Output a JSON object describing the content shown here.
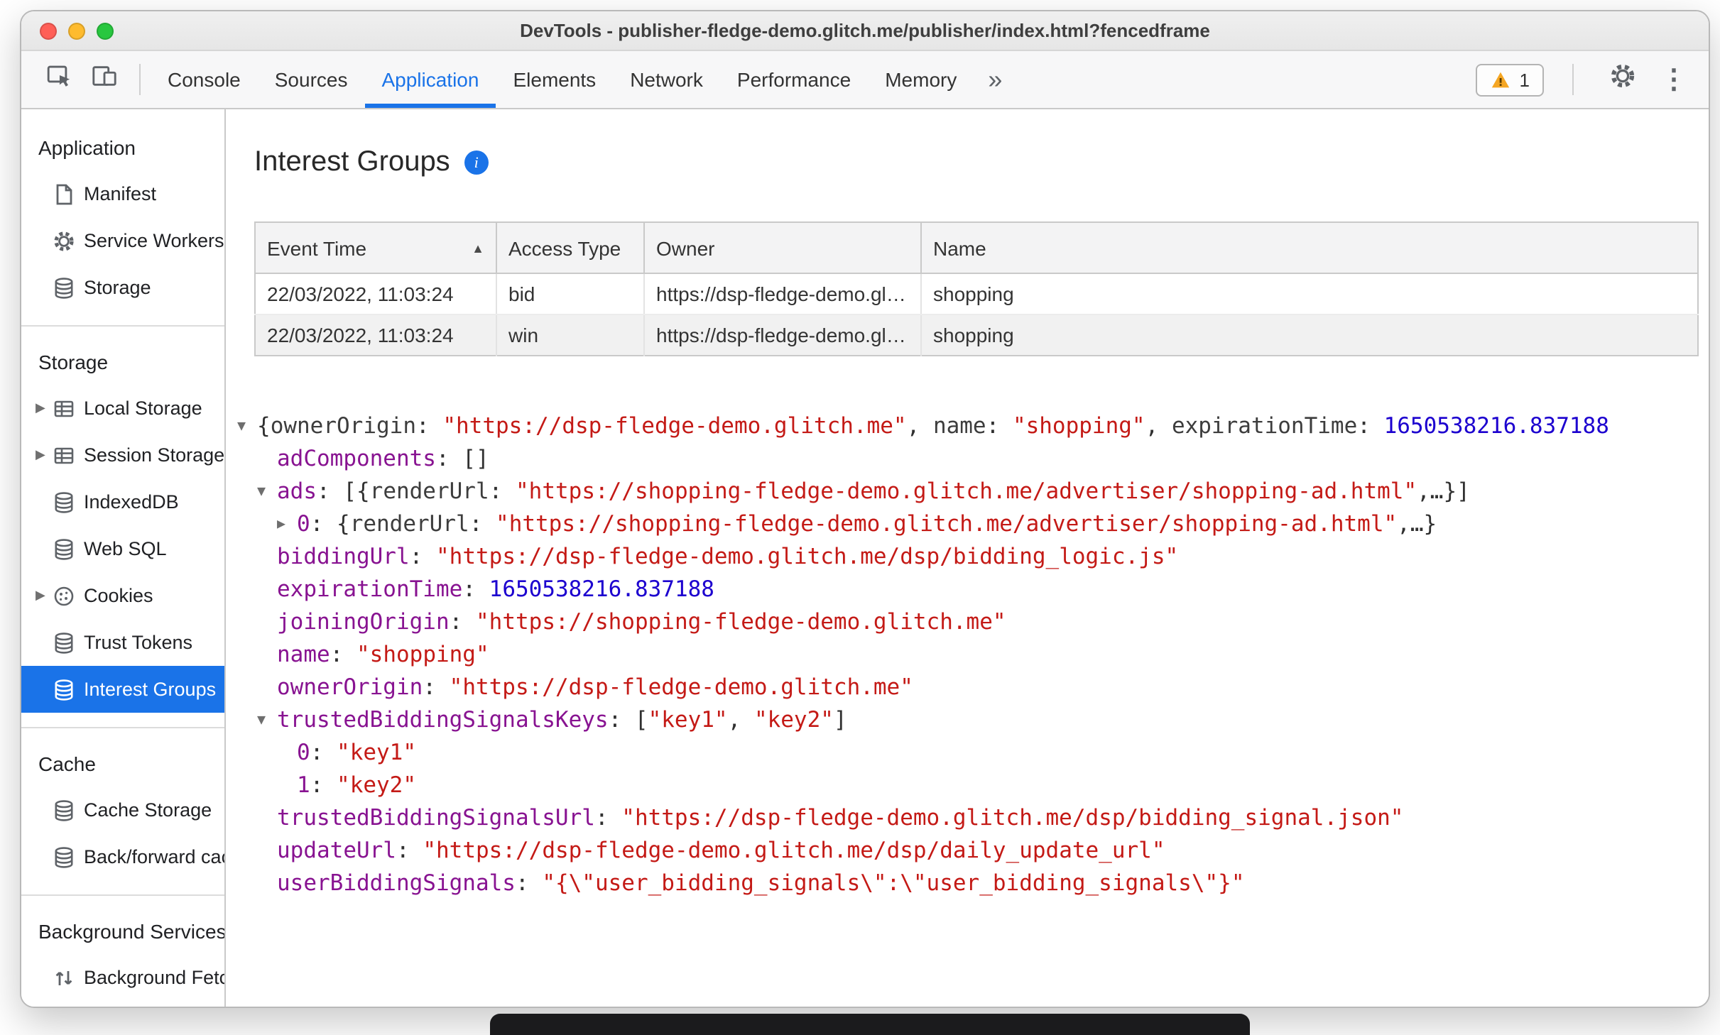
{
  "window_title": "DevTools - publisher-fledge-demo.glitch.me/publisher/index.html?fencedframe",
  "colors": {
    "accent": "#1a73e8",
    "selected_item_bg": "#1a73e8",
    "tree_key": "#881391",
    "tree_string": "#c41a16",
    "tree_number": "#1c00cf",
    "warning": "#f5a623"
  },
  "toolbar": {
    "tabs": [
      {
        "label": "Console"
      },
      {
        "label": "Sources"
      },
      {
        "label": "Application",
        "active": true
      },
      {
        "label": "Elements"
      },
      {
        "label": "Network"
      },
      {
        "label": "Performance"
      },
      {
        "label": "Memory"
      }
    ],
    "more_tabs_label": "»",
    "issues_count": "1"
  },
  "sidebar": {
    "sections": [
      {
        "title": "Application",
        "items": [
          {
            "label": "Manifest",
            "icon": "manifest"
          },
          {
            "label": "Service Workers",
            "icon": "gear"
          },
          {
            "label": "Storage",
            "icon": "database"
          }
        ]
      },
      {
        "title": "Storage",
        "items": [
          {
            "label": "Local Storage",
            "icon": "grid",
            "expandable": true
          },
          {
            "label": "Session Storage",
            "icon": "grid",
            "expandable": true
          },
          {
            "label": "IndexedDB",
            "icon": "database"
          },
          {
            "label": "Web SQL",
            "icon": "database"
          },
          {
            "label": "Cookies",
            "icon": "cookie",
            "expandable": true
          },
          {
            "label": "Trust Tokens",
            "icon": "database"
          },
          {
            "label": "Interest Groups",
            "icon": "database",
            "selected": true
          }
        ]
      },
      {
        "title": "Cache",
        "items": [
          {
            "label": "Cache Storage",
            "icon": "database"
          },
          {
            "label": "Back/forward cache",
            "icon": "database"
          }
        ]
      },
      {
        "title": "Background Services",
        "items": [
          {
            "label": "Background Fetch",
            "icon": "updown"
          }
        ]
      }
    ]
  },
  "main": {
    "heading": "Interest Groups",
    "table": {
      "columns": [
        {
          "label": "Event Time",
          "sort": "asc"
        },
        {
          "label": "Access Type"
        },
        {
          "label": "Owner"
        },
        {
          "label": "Name"
        }
      ],
      "rows": [
        [
          "22/03/2022, 11:03:24",
          "bid",
          "https://dsp-fledge-demo.glitch.me",
          "shopping"
        ],
        [
          "22/03/2022, 11:03:24",
          "win",
          "https://dsp-fledge-demo.glitch.me",
          "shopping"
        ]
      ]
    },
    "tree": {
      "lines": [
        {
          "indent": 0,
          "arrow": "expanded",
          "segments": [
            [
              "p",
              "{"
            ],
            [
              "pk",
              "ownerOrigin"
            ],
            [
              "p",
              ": "
            ],
            [
              "s",
              "\"https://dsp-fledge-demo.glitch.me\""
            ],
            [
              "p",
              ", "
            ],
            [
              "pk",
              "name"
            ],
            [
              "p",
              ": "
            ],
            [
              "s",
              "\"shopping\""
            ],
            [
              "p",
              ", "
            ],
            [
              "pk",
              "expirationTime"
            ],
            [
              "p",
              ": "
            ],
            [
              "n",
              "1650538216.837188"
            ]
          ]
        },
        {
          "indent": 1,
          "arrow": null,
          "segments": [
            [
              "k",
              "adComponents"
            ],
            [
              "p",
              ": []"
            ]
          ]
        },
        {
          "indent": 1,
          "arrow": "expanded",
          "segments": [
            [
              "k",
              "ads"
            ],
            [
              "p",
              ": [{"
            ],
            [
              "pk",
              "renderUrl"
            ],
            [
              "p",
              ": "
            ],
            [
              "s",
              "\"https://shopping-fledge-demo.glitch.me/advertiser/shopping-ad.html\""
            ],
            [
              "p",
              ",…}]"
            ]
          ]
        },
        {
          "indent": 2,
          "arrow": "collapsed",
          "segments": [
            [
              "k",
              "0"
            ],
            [
              "p",
              ": {"
            ],
            [
              "pk",
              "renderUrl"
            ],
            [
              "p",
              ": "
            ],
            [
              "s",
              "\"https://shopping-fledge-demo.glitch.me/advertiser/shopping-ad.html\""
            ],
            [
              "p",
              ",…}"
            ]
          ]
        },
        {
          "indent": 1,
          "arrow": null,
          "segments": [
            [
              "k",
              "biddingUrl"
            ],
            [
              "p",
              ": "
            ],
            [
              "s",
              "\"https://dsp-fledge-demo.glitch.me/dsp/bidding_logic.js\""
            ]
          ]
        },
        {
          "indent": 1,
          "arrow": null,
          "segments": [
            [
              "k",
              "expirationTime"
            ],
            [
              "p",
              ": "
            ],
            [
              "n",
              "1650538216.837188"
            ]
          ]
        },
        {
          "indent": 1,
          "arrow": null,
          "segments": [
            [
              "k",
              "joiningOrigin"
            ],
            [
              "p",
              ": "
            ],
            [
              "s",
              "\"https://shopping-fledge-demo.glitch.me\""
            ]
          ]
        },
        {
          "indent": 1,
          "arrow": null,
          "segments": [
            [
              "k",
              "name"
            ],
            [
              "p",
              ": "
            ],
            [
              "s",
              "\"shopping\""
            ]
          ]
        },
        {
          "indent": 1,
          "arrow": null,
          "segments": [
            [
              "k",
              "ownerOrigin"
            ],
            [
              "p",
              ": "
            ],
            [
              "s",
              "\"https://dsp-fledge-demo.glitch.me\""
            ]
          ]
        },
        {
          "indent": 1,
          "arrow": "expanded",
          "segments": [
            [
              "k",
              "trustedBiddingSignalsKeys"
            ],
            [
              "p",
              ": ["
            ],
            [
              "s",
              "\"key1\""
            ],
            [
              "p",
              ", "
            ],
            [
              "s",
              "\"key2\""
            ],
            [
              "p",
              "]"
            ]
          ]
        },
        {
          "indent": 2,
          "arrow": null,
          "segments": [
            [
              "k",
              "0"
            ],
            [
              "p",
              ": "
            ],
            [
              "s",
              "\"key1\""
            ]
          ]
        },
        {
          "indent": 2,
          "arrow": null,
          "segments": [
            [
              "k",
              "1"
            ],
            [
              "p",
              ": "
            ],
            [
              "s",
              "\"key2\""
            ]
          ]
        },
        {
          "indent": 1,
          "arrow": null,
          "segments": [
            [
              "k",
              "trustedBiddingSignalsUrl"
            ],
            [
              "p",
              ": "
            ],
            [
              "s",
              "\"https://dsp-fledge-demo.glitch.me/dsp/bidding_signal.json\""
            ]
          ]
        },
        {
          "indent": 1,
          "arrow": null,
          "segments": [
            [
              "k",
              "updateUrl"
            ],
            [
              "p",
              ": "
            ],
            [
              "s",
              "\"https://dsp-fledge-demo.glitch.me/dsp/daily_update_url\""
            ]
          ]
        },
        {
          "indent": 1,
          "arrow": null,
          "segments": [
            [
              "k",
              "userBiddingSignals"
            ],
            [
              "p",
              ": "
            ],
            [
              "s",
              "\"{\\\"user_bidding_signals\\\":\\\"user_bidding_signals\\\"}\""
            ]
          ]
        }
      ]
    }
  }
}
